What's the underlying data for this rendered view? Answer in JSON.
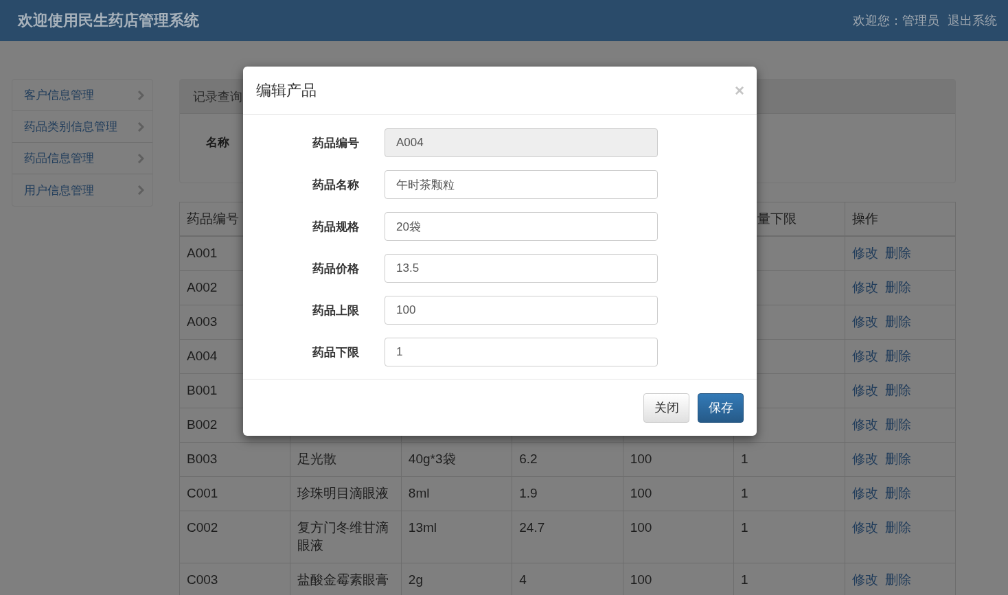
{
  "header": {
    "title": "欢迎使用民生药店管理系统",
    "user": "欢迎您：管理员",
    "logout": "退出系统"
  },
  "sidebar": {
    "items": [
      {
        "label": "客户信息管理"
      },
      {
        "label": "药品类别信息管理"
      },
      {
        "label": "药品信息管理"
      },
      {
        "label": "用户信息管理"
      }
    ]
  },
  "query_panel": {
    "heading": "记录查询",
    "label": "名称"
  },
  "table": {
    "columns": [
      {
        "label": "药品编号"
      },
      {},
      {},
      {},
      {},
      {
        "label": "量下限",
        "cut": true
      },
      {
        "label": "操作"
      }
    ],
    "rows": [
      {
        "cells": [
          "A001"
        ],
        "actions": [
          "修改",
          "删除"
        ]
      },
      {
        "cells": [
          "A002"
        ],
        "actions": [
          "修改",
          "删除"
        ]
      },
      {
        "cells": [
          "A003"
        ],
        "actions": [
          "修改",
          "删除"
        ]
      },
      {
        "cells": [
          "A004"
        ],
        "actions": [
          "修改",
          "删除"
        ]
      },
      {
        "cells": [
          "B001"
        ],
        "actions": [
          "修改",
          "删除"
        ]
      },
      {
        "cells": [
          "B002"
        ],
        "actions": [
          "修改",
          "删除"
        ]
      },
      {
        "cells": [
          "B003",
          "足光散",
          "40g*3袋",
          "6.2",
          "100",
          "1"
        ],
        "actions": [
          "修改",
          "删除"
        ]
      },
      {
        "cells": [
          "C001",
          "珍珠明目滴眼液",
          "8ml",
          "1.9",
          "100",
          "1"
        ],
        "actions": [
          "修改",
          "删除"
        ]
      },
      {
        "cells": [
          "C002",
          "复方门冬维甘滴眼液",
          "13ml",
          "24.7",
          "100",
          "1"
        ],
        "actions": [
          "修改",
          "删除"
        ]
      },
      {
        "cells": [
          "C003",
          "盐酸金霉素眼膏",
          "2g",
          "4",
          "100",
          "1"
        ],
        "actions": [
          "修改",
          "删除"
        ]
      }
    ]
  },
  "dialog": {
    "title": "编辑产品",
    "close": "×",
    "fields": [
      {
        "label": "药品编号",
        "value": "A004",
        "disabled": true
      },
      {
        "label": "药品名称",
        "value": "午时茶颗粒",
        "disabled": false
      },
      {
        "label": "药品规格",
        "value": "20袋",
        "disabled": false
      },
      {
        "label": "药品价格",
        "value": "13.5",
        "disabled": false
      },
      {
        "label": "药品上限",
        "value": "100",
        "disabled": false
      },
      {
        "label": "药品下限",
        "value": "1",
        "disabled": false
      }
    ],
    "buttons": [
      {
        "label": "关闭",
        "kind": "default"
      },
      {
        "label": "保存",
        "kind": "primary"
      }
    ]
  }
}
